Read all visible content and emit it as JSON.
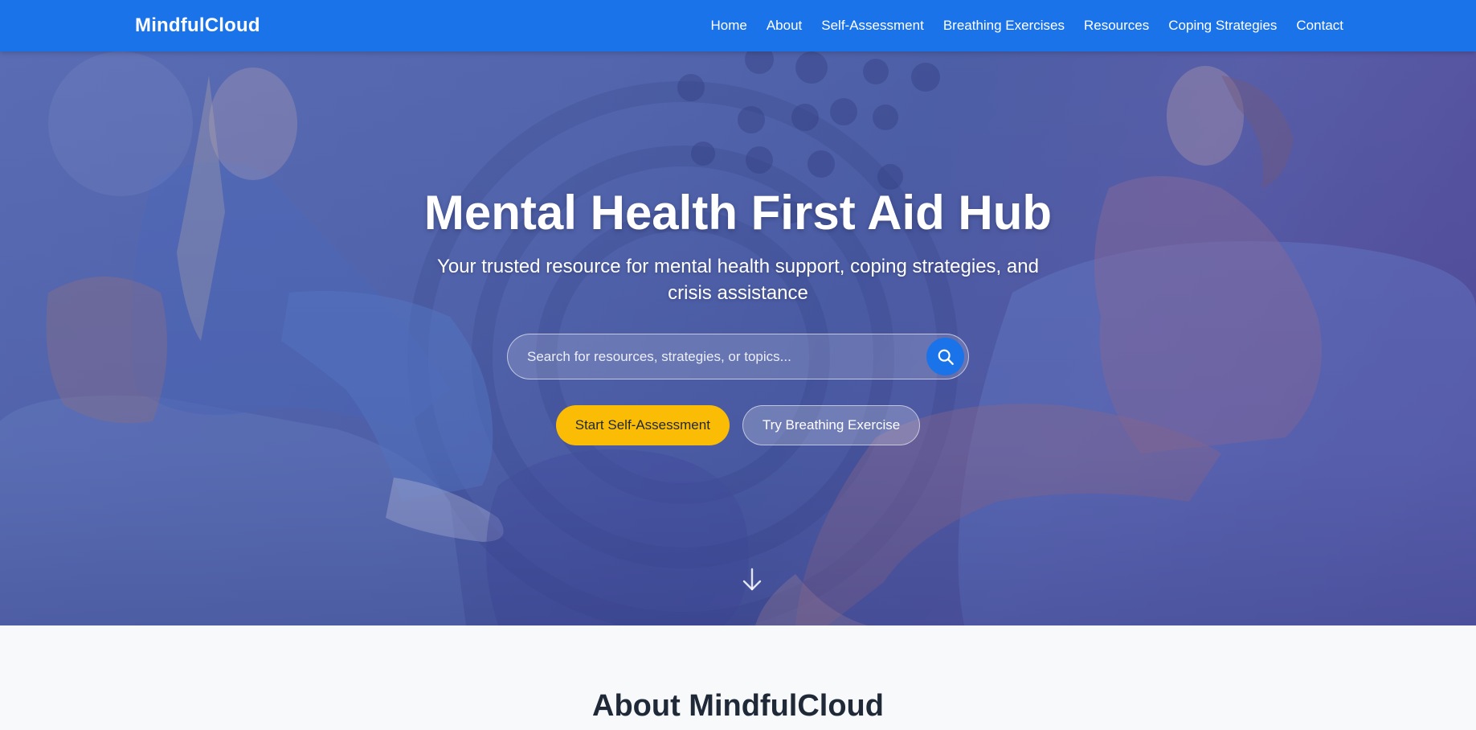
{
  "navbar": {
    "brand": "MindfulCloud",
    "links": [
      "Home",
      "About",
      "Self-Assessment",
      "Breathing Exercises",
      "Resources",
      "Coping Strategies",
      "Contact"
    ]
  },
  "hero": {
    "title": "Mental Health First Aid Hub",
    "subtitle": "Your trusted resource for mental health support, coping strategies, and crisis assistance",
    "search": {
      "placeholder": "Search for resources, strategies, or topics...",
      "value": ""
    },
    "buttons": {
      "primary": "Start Self-Assessment",
      "secondary": "Try Breathing Exercise"
    }
  },
  "about": {
    "title": "About MindfulCloud"
  },
  "icons": {
    "search": "search-icon",
    "scroll": "arrow-down-icon"
  },
  "colors": {
    "nav": "#1a73e8",
    "accent": "#fbbc05",
    "hero_overlay": "#5568ae",
    "heading": "#1f2937"
  }
}
